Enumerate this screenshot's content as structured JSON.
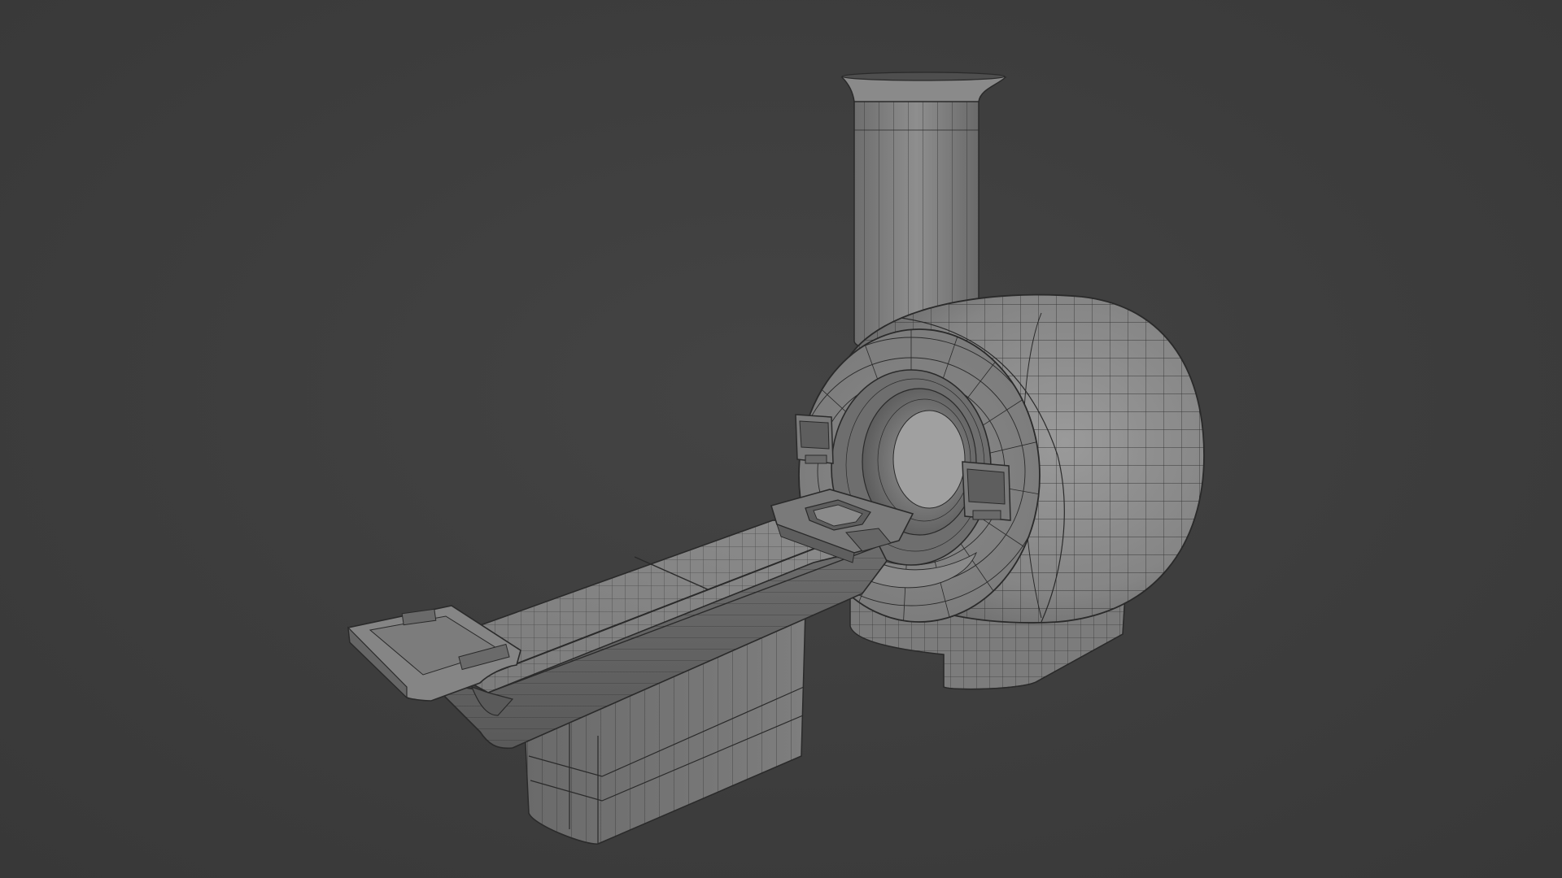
{
  "viewport": {
    "background_color": "#3d3d3d",
    "render_mode": "solid-with-wireframe-overlay"
  },
  "scene": {
    "subject": "mri-scanner",
    "parts": [
      "exhaust-chimney",
      "magnet-gantry",
      "bore-opening",
      "gantry-base",
      "front-control-panel-left",
      "front-control-panel-right",
      "patient-table",
      "table-head-coil",
      "table-base-pedestal",
      "table-foot-end"
    ],
    "colors": {
      "surface_light": "#8c8c8c",
      "surface_mid": "#7a7a7a",
      "surface_dark": "#5e5e5e",
      "wire": "#2a2a2a"
    }
  }
}
